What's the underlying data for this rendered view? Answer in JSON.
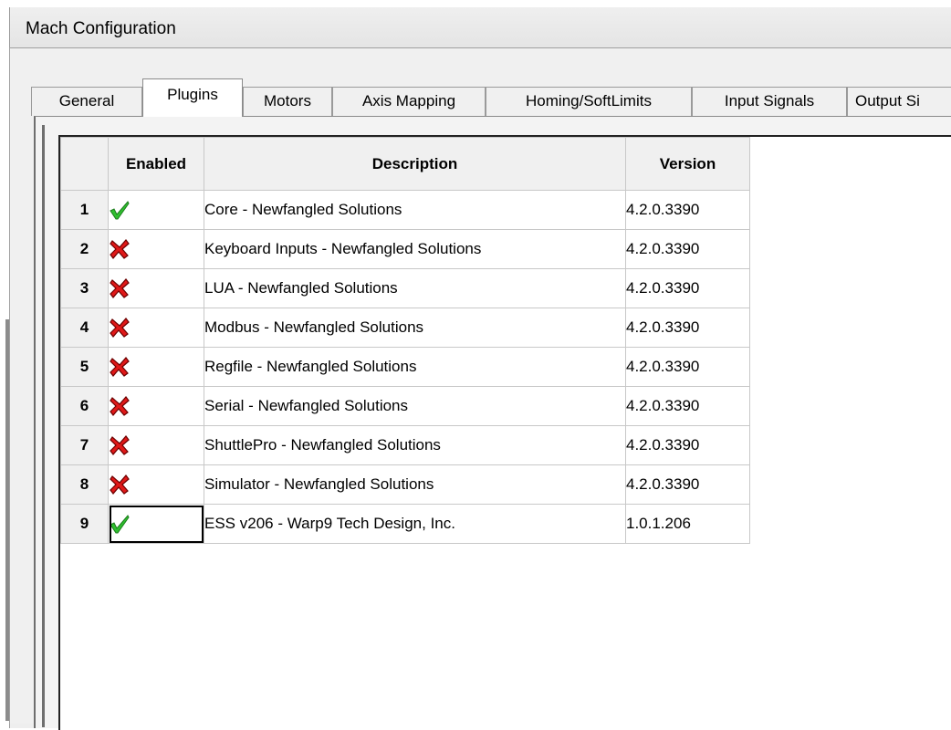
{
  "window": {
    "title": "Mach Configuration"
  },
  "tabs": [
    {
      "label": "General",
      "active": false
    },
    {
      "label": "Plugins",
      "active": true
    },
    {
      "label": "Motors",
      "active": false
    },
    {
      "label": "Axis Mapping",
      "active": false
    },
    {
      "label": "Homing/SoftLimits",
      "active": false
    },
    {
      "label": "Input Signals",
      "active": false
    },
    {
      "label": "Output Si",
      "active": false
    }
  ],
  "grid": {
    "headers": {
      "enabled": "Enabled",
      "description": "Description",
      "version": "Version"
    },
    "rows": [
      {
        "num": "1",
        "enabled": true,
        "description": "Core - Newfangled Solutions",
        "version": "4.2.0.3390"
      },
      {
        "num": "2",
        "enabled": false,
        "description": "Keyboard Inputs - Newfangled Solutions",
        "version": "4.2.0.3390"
      },
      {
        "num": "3",
        "enabled": false,
        "description": "LUA - Newfangled Solutions",
        "version": "4.2.0.3390"
      },
      {
        "num": "4",
        "enabled": false,
        "description": "Modbus - Newfangled Solutions",
        "version": "4.2.0.3390"
      },
      {
        "num": "5",
        "enabled": false,
        "description": "Regfile - Newfangled Solutions",
        "version": "4.2.0.3390"
      },
      {
        "num": "6",
        "enabled": false,
        "description": "Serial - Newfangled Solutions",
        "version": "4.2.0.3390"
      },
      {
        "num": "7",
        "enabled": false,
        "description": "ShuttlePro - Newfangled Solutions",
        "version": "4.2.0.3390"
      },
      {
        "num": "8",
        "enabled": false,
        "description": "Simulator - Newfangled Solutions",
        "version": "4.2.0.3390"
      },
      {
        "num": "9",
        "enabled": true,
        "description": "ESS v206 - Warp9 Tech Design, Inc.",
        "version": "1.0.1.206",
        "selected": true
      }
    ]
  },
  "icons": {
    "enabled": "checkmark-icon",
    "disabled": "red-x-icon"
  },
  "colors": {
    "check_green": "#2fbf2f",
    "x_red": "#e01818"
  }
}
